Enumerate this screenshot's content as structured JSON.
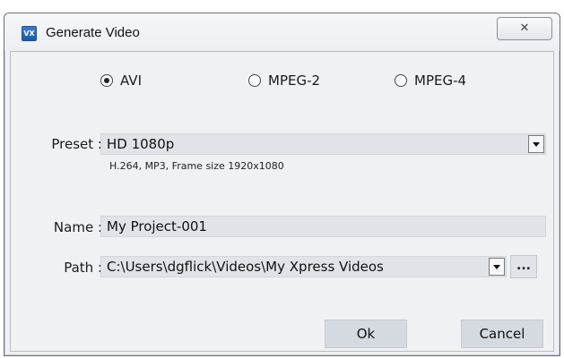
{
  "window": {
    "title": "Generate Video",
    "icon": "vx-app-icon",
    "icon_text": "VX",
    "close_glyph": "✕"
  },
  "format": {
    "options": [
      "AVI",
      "MPEG-2",
      "MPEG-4"
    ],
    "selected": "AVI"
  },
  "preset": {
    "label": "Preset :",
    "value": "HD 1080p",
    "description": "H.264, MP3, Frame size 1920x1080"
  },
  "name": {
    "label": "Name :",
    "value": "My Project-001"
  },
  "path": {
    "label": "Path :",
    "value": "C:\\Users\\dgflick\\Videos\\My Xpress Videos",
    "browse_label": "..."
  },
  "buttons": {
    "ok": "Ok",
    "cancel": "Cancel"
  }
}
